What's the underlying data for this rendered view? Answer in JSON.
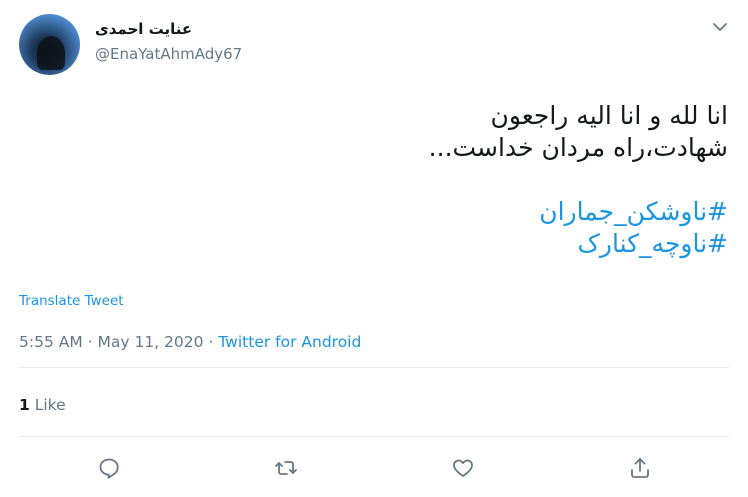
{
  "author": {
    "display_name": "عنایت احمدی",
    "handle": "@EnaYatAhmAdy67"
  },
  "tweet": {
    "lines": [
      "انا لله و انا الیه راجعون",
      "شهادت،راه مردان خداست..."
    ],
    "hashtags": [
      "#ناوشکن_جماران",
      "#ناوچه_کنارک"
    ]
  },
  "translate_label": "Translate Tweet",
  "meta": {
    "time": "5:55 AM",
    "sep1": " · ",
    "date": "May 11, 2020",
    "sep2": " · ",
    "source": "Twitter for Android"
  },
  "stats": {
    "likes_count": "1",
    "likes_label": "Like"
  },
  "icons": {
    "reply": "reply-icon",
    "retweet": "retweet-icon",
    "like": "heart-icon",
    "share": "share-icon",
    "caret": "chevron-down-icon"
  },
  "colors": {
    "link": "#1b95e0",
    "secondary": "#657786",
    "text": "#14171a"
  }
}
